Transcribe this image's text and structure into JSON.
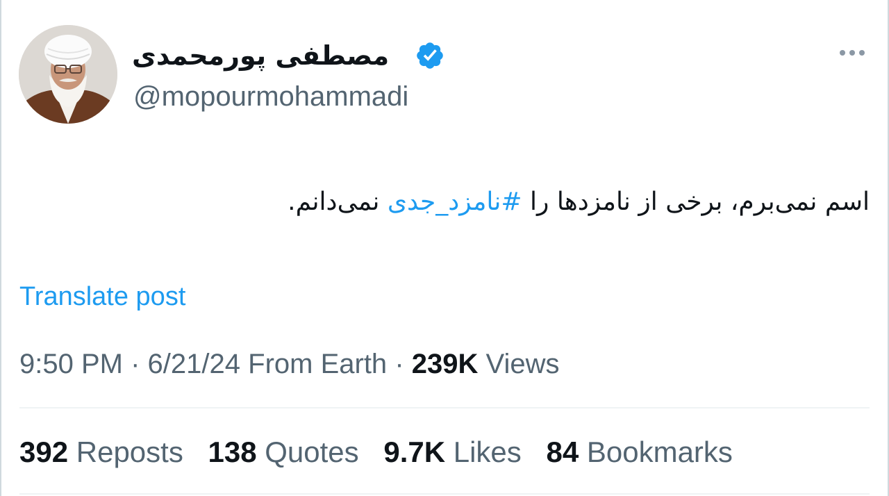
{
  "post": {
    "display_name": "مصطفی پورمحمدی",
    "handle": "@mopourmohammadi",
    "text_before": "اسم نمی‌برم، برخی از نامزدها را ",
    "hashtag": "#نامزد_جدی",
    "text_after": " نمی‌دانم.",
    "translate_label": "Translate post",
    "time": "9:50 PM",
    "separator": "·",
    "date": "6/21/24",
    "source": "From Earth",
    "views_count": "239K",
    "views_label": "Views"
  },
  "stats": [
    {
      "count": "392",
      "label": "Reposts"
    },
    {
      "count": "138",
      "label": "Quotes"
    },
    {
      "count": "9.7K",
      "label": "Likes"
    },
    {
      "count": "84",
      "label": "Bookmarks"
    }
  ],
  "icons": {
    "verified": "verified-badge-icon",
    "more": "more-options-icon"
  },
  "colors": {
    "accent": "#1d9bf0",
    "text": "#0f1419",
    "secondary_text": "#536471",
    "divider": "#eff3f4"
  }
}
